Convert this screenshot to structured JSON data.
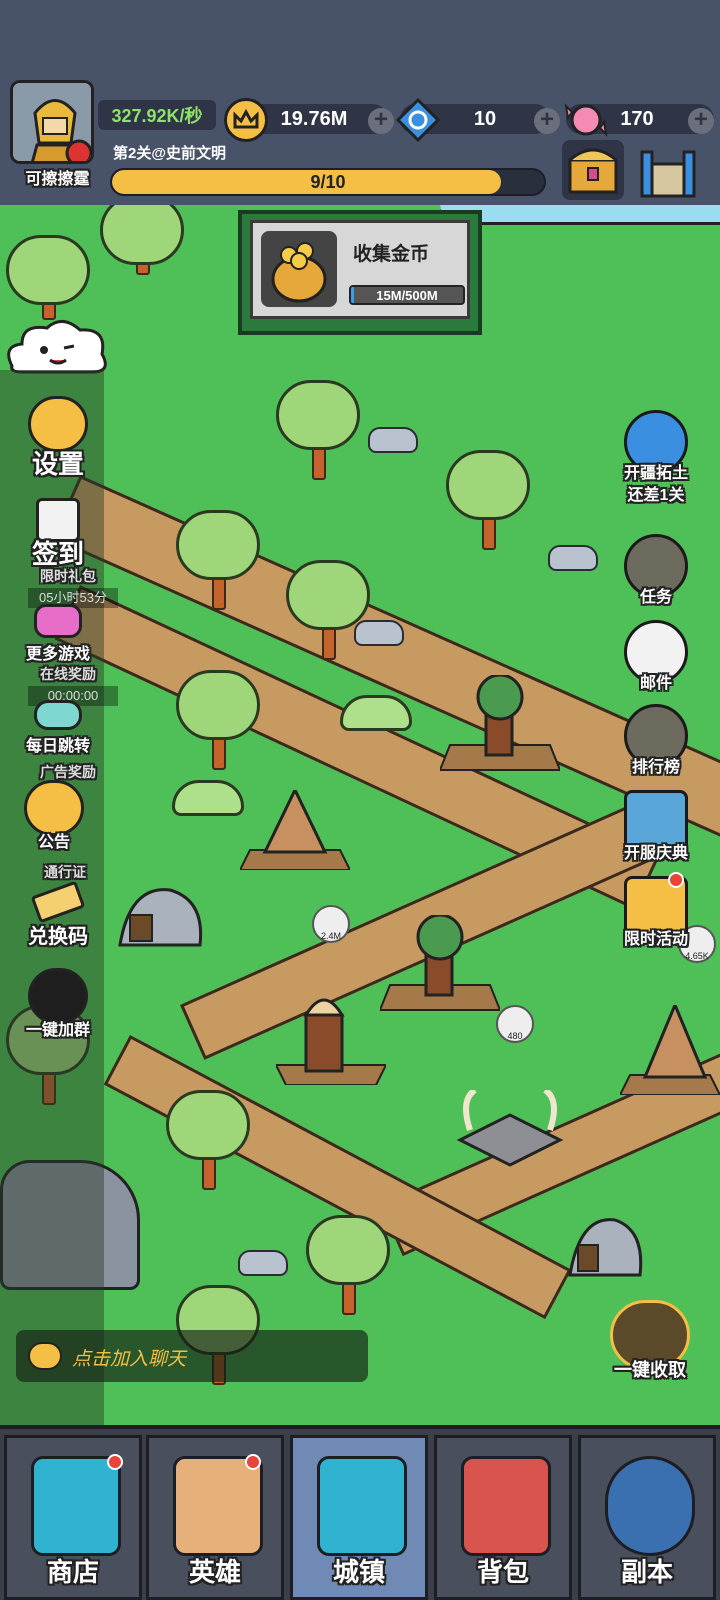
{
  "player": {
    "name": "可擦擦霆",
    "rate": "327.92K/秒"
  },
  "resources": [
    {
      "id": "crown",
      "value": "19.76M"
    },
    {
      "id": "gem",
      "value": "10"
    },
    {
      "id": "candy",
      "value": "170"
    }
  ],
  "stage": {
    "label": "第2关@史前文明",
    "progress_text": "9/10",
    "progress": 0.9
  },
  "collect": {
    "title": "收集金币",
    "progress_text": "15M/500M",
    "progress": 0.03
  },
  "left_menu": [
    {
      "key": "settings",
      "label": "设置",
      "icon": "gear-icon"
    },
    {
      "key": "checkin",
      "label": "签到",
      "icon": "calendar-icon",
      "sub": "限时礼包",
      "timer": "05小时53分"
    },
    {
      "key": "more_games",
      "label": "更多游戏",
      "icon": "gamepad-icon",
      "sub": "在线奖励",
      "timer": "00:00:00"
    },
    {
      "key": "daily_jump",
      "label": "每日跳转",
      "icon": "tap-icon",
      "sub": "广告奖励"
    },
    {
      "key": "notice",
      "label": "公告",
      "icon": "megaphone-icon",
      "sub": "通行证"
    },
    {
      "key": "redeem",
      "label": "兑换码",
      "icon": "ticket-icon"
    },
    {
      "key": "join_group",
      "label": "一键加群",
      "icon": "penguin-icon"
    }
  ],
  "right_menu": [
    {
      "key": "expand",
      "label": "开疆拓土",
      "label2": "还差1关",
      "icon": "globe-icon"
    },
    {
      "key": "tasks",
      "label": "任务",
      "icon": "lock-icon"
    },
    {
      "key": "mail",
      "label": "邮件",
      "icon": "mail-icon"
    },
    {
      "key": "rank",
      "label": "排行榜",
      "icon": "lock-icon"
    },
    {
      "key": "server_event",
      "label": "开服庆典",
      "icon": "map-icon"
    },
    {
      "key": "limited_event",
      "label": "限时活动",
      "icon": "party-icon"
    }
  ],
  "collect_all": {
    "label": "一键收取"
  },
  "chat": {
    "placeholder": "点击加入聊天"
  },
  "bottom_nav": [
    {
      "key": "shop",
      "label": "商店",
      "icon": "shop-icon",
      "badge": true,
      "active": false
    },
    {
      "key": "heroes",
      "label": "英雄",
      "icon": "caveman-icon",
      "badge": true,
      "active": false
    },
    {
      "key": "town",
      "label": "城镇",
      "icon": "building-icon",
      "badge": false,
      "active": true
    },
    {
      "key": "bag",
      "label": "背包",
      "icon": "backpack-icon",
      "badge": false,
      "active": false
    },
    {
      "key": "dungeon",
      "label": "副本",
      "icon": "locked-globe-icon",
      "badge": false,
      "active": false
    }
  ],
  "map_labels": {
    "building1": "2.4M",
    "building2": "480",
    "building3": "4.65K"
  },
  "colors": {
    "grass": "#4fbf57",
    "path": "#c79a62",
    "accent": "#f5be45",
    "rate": "#8fe26a"
  }
}
